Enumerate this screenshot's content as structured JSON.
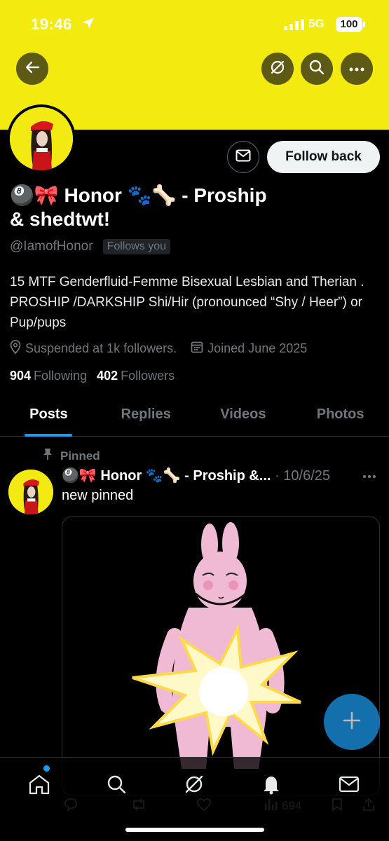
{
  "status_bar": {
    "time": "19:46",
    "network": "5G",
    "battery": "100"
  },
  "header": {
    "back_icon": "back-arrow-icon",
    "grok_icon": "grok-icon",
    "search_icon": "search-icon",
    "more_icon": "more-icon"
  },
  "profile": {
    "follow_label": "Follow back",
    "name_line1": "🎱🎀 Honor 🐾🦴 - Proship",
    "name_line2": "& shedtwt!",
    "handle": "@IamofHonor",
    "follows_you": "Follows you",
    "bio": "15 MTF Genderfluid-Femme Bisexual Lesbian and Therian . PROSHIP /DARKSHIP Shi/Hir (pronounced “Shy / Heer”) or Pup/pups",
    "location": "Suspended at 1k followers.",
    "joined": "Joined June 2025",
    "following_count": "904",
    "following_label": "Following",
    "followers_count": "402",
    "followers_label": "Followers"
  },
  "tabs": [
    {
      "label": "Posts",
      "active": true
    },
    {
      "label": "Replies",
      "active": false
    },
    {
      "label": "Videos",
      "active": false
    },
    {
      "label": "Photos",
      "active": false
    }
  ],
  "post": {
    "pinned_label": "Pinned",
    "author": "🎱🎀 Honor 🐾🦴 - Proship &...",
    "date": "10/6/25",
    "text": "new pinned",
    "views": "694"
  },
  "bottom_nav": [
    "home-icon",
    "search-icon",
    "grok-icon",
    "bell-icon",
    "mail-icon"
  ],
  "colors": {
    "banner": "#f3ea10",
    "accent": "#1d9bf0",
    "background": "#000000",
    "muted_text": "#71767b"
  }
}
